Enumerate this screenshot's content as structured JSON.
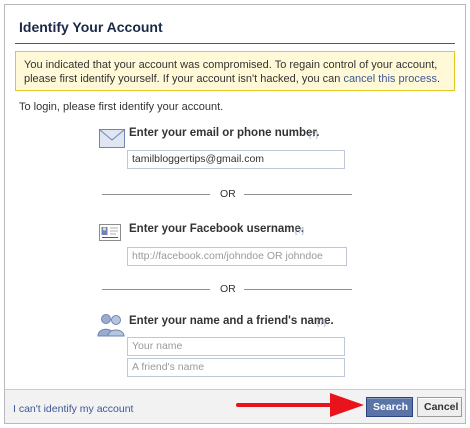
{
  "dialog": {
    "title": "Identify Your Account",
    "notice_text": "You indicated that your account was compromised. To regain control of your account, please first identify yourself. If your account isn't hacked, you can ",
    "notice_link": "cancel this process",
    "notice_end": ".",
    "intro": "To login, please first identify your account."
  },
  "email_section": {
    "label": "Enter your email or phone number.",
    "help": "[?]",
    "value": "tamilbloggertips@gmail.com"
  },
  "separator_text": "OR",
  "username_section": {
    "label": "Enter your Facebook username.",
    "help": "[?]",
    "placeholder": "http://facebook.com/johndoe OR johndoe"
  },
  "name_section": {
    "label": "Enter your name and a friend's name.",
    "help": "[?]",
    "name_placeholder": "Your name",
    "friend_placeholder": "A friend's name"
  },
  "footer": {
    "link": "I can't identify my account",
    "search_label": "Search",
    "cancel_label": "Cancel"
  },
  "icons": {
    "email": "envelope-icon",
    "username": "id-card-icon",
    "name": "people-icon",
    "annotation": "red-arrow-icon"
  },
  "colors": {
    "brand": "#3b5998",
    "notice_bg": "#fff9d7",
    "notice_border": "#e2c822",
    "search_button": "#5b74a8",
    "arrow": "#e8131b"
  }
}
